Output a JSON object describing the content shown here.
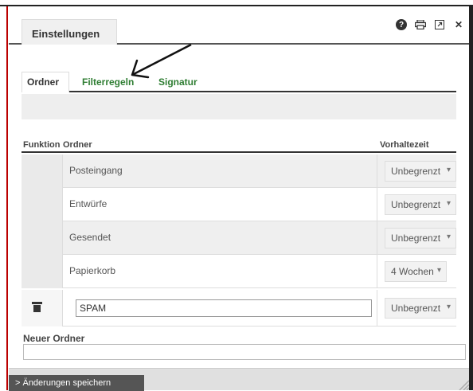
{
  "dialog": {
    "title_tab": "Einstellungen",
    "icons": [
      "help-icon",
      "print-icon",
      "popout-icon",
      "close-icon"
    ]
  },
  "tabs": [
    {
      "label": "Ordner",
      "active": true
    },
    {
      "label": "Filterregeln",
      "active": false
    },
    {
      "label": "Signatur",
      "active": false
    }
  ],
  "table": {
    "headers": {
      "function": "Funktion",
      "folder": "Ordner",
      "retention": "Vorhaltezeit"
    },
    "rows": [
      {
        "name": "Posteingang",
        "retention": "Unbegrenzt"
      },
      {
        "name": "Entwürfe",
        "retention": "Unbegrenzt"
      },
      {
        "name": "Gesendet",
        "retention": "Unbegrenzt"
      },
      {
        "name": "Papierkorb",
        "retention": "4 Wochen"
      }
    ],
    "custom_row": {
      "name": "SPAM",
      "retention": "Unbegrenzt"
    }
  },
  "new_folder": {
    "label": "Neuer Ordner",
    "value": ""
  },
  "footer": {
    "save_label": "> Änderungen speichern"
  },
  "colors": {
    "tab_link": "#2e7d32",
    "accent_dark": "#333333"
  }
}
